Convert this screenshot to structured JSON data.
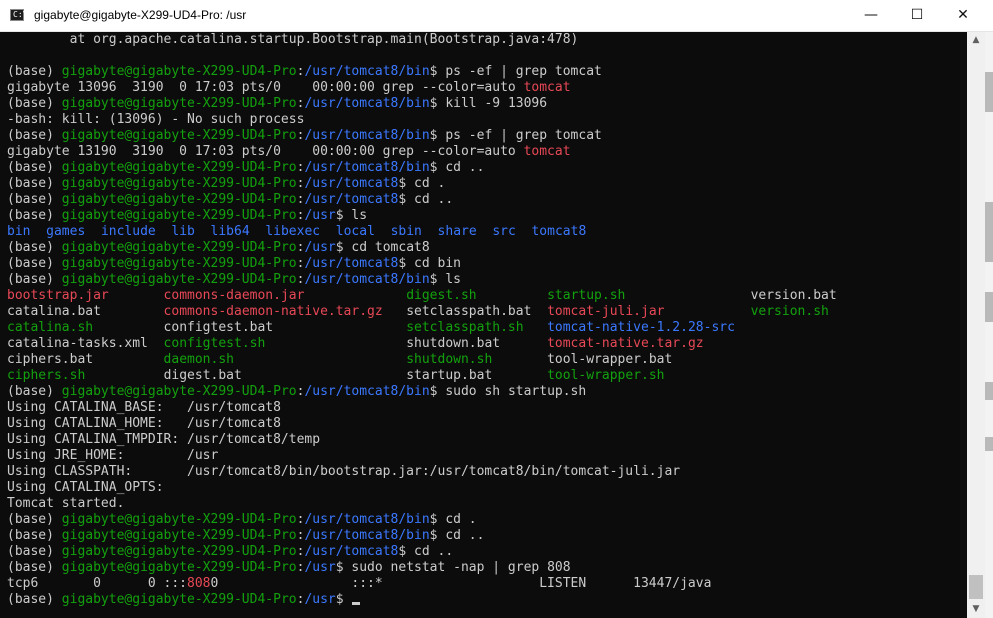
{
  "window": {
    "title": "gigabyte@gigabyte-X299-UD4-Pro: /usr",
    "icon": "terminal-icon",
    "icon_glyph": "C:\\",
    "minimize_glyph": "—",
    "maximize_glyph": "☐",
    "close_glyph": "✕"
  },
  "scrollbar": {
    "up_glyph": "▲",
    "down_glyph": "▼",
    "position": 0.97
  },
  "colors": {
    "background": "#0c0c0c",
    "text": "#cccccc",
    "prompt_user": "#13a10e",
    "prompt_path": "#3b78ff",
    "directory": "#3b78ff",
    "executable": "#13a10e",
    "archive": "#e74856",
    "match": "#e74856"
  },
  "terminal": {
    "lines": [
      [
        [
          "w",
          "        at org.apache.catalina.startup.Bootstrap.main(Bootstrap.java:478)"
        ]
      ],
      [
        [
          "w",
          ""
        ]
      ],
      [
        [
          "w",
          "(base) "
        ],
        [
          "g",
          "gigabyte@gigabyte-X299-UD4-Pro"
        ],
        [
          "w",
          ":"
        ],
        [
          "b",
          "/usr/tomcat8/bin"
        ],
        [
          "w",
          "$ ps -ef | grep tomcat"
        ]
      ],
      [
        [
          "w",
          "gigabyte 13096  3190  0 17:03 pts/0    00:00:00 grep --color=auto "
        ],
        [
          "r",
          "tomcat"
        ]
      ],
      [
        [
          "w",
          "(base) "
        ],
        [
          "g",
          "gigabyte@gigabyte-X299-UD4-Pro"
        ],
        [
          "w",
          ":"
        ],
        [
          "b",
          "/usr/tomcat8/bin"
        ],
        [
          "w",
          "$ kill -9 13096"
        ]
      ],
      [
        [
          "w",
          "-bash: kill: (13096) - No such process"
        ]
      ],
      [
        [
          "w",
          "(base) "
        ],
        [
          "g",
          "gigabyte@gigabyte-X299-UD4-Pro"
        ],
        [
          "w",
          ":"
        ],
        [
          "b",
          "/usr/tomcat8/bin"
        ],
        [
          "w",
          "$ ps -ef | grep tomcat"
        ]
      ],
      [
        [
          "w",
          "gigabyte 13190  3190  0 17:03 pts/0    00:00:00 grep --color=auto "
        ],
        [
          "r",
          "tomcat"
        ]
      ],
      [
        [
          "w",
          "(base) "
        ],
        [
          "g",
          "gigabyte@gigabyte-X299-UD4-Pro"
        ],
        [
          "w",
          ":"
        ],
        [
          "b",
          "/usr/tomcat8/bin"
        ],
        [
          "w",
          "$ cd .."
        ]
      ],
      [
        [
          "w",
          "(base) "
        ],
        [
          "g",
          "gigabyte@gigabyte-X299-UD4-Pro"
        ],
        [
          "w",
          ":"
        ],
        [
          "b",
          "/usr/tomcat8"
        ],
        [
          "w",
          "$ cd ."
        ]
      ],
      [
        [
          "w",
          "(base) "
        ],
        [
          "g",
          "gigabyte@gigabyte-X299-UD4-Pro"
        ],
        [
          "w",
          ":"
        ],
        [
          "b",
          "/usr/tomcat8"
        ],
        [
          "w",
          "$ cd .."
        ]
      ],
      [
        [
          "w",
          "(base) "
        ],
        [
          "g",
          "gigabyte@gigabyte-X299-UD4-Pro"
        ],
        [
          "w",
          ":"
        ],
        [
          "b",
          "/usr"
        ],
        [
          "w",
          "$ ls"
        ]
      ],
      [
        [
          "b",
          "bin"
        ],
        [
          "w",
          "  "
        ],
        [
          "b",
          "games"
        ],
        [
          "w",
          "  "
        ],
        [
          "b",
          "include"
        ],
        [
          "w",
          "  "
        ],
        [
          "b",
          "lib"
        ],
        [
          "w",
          "  "
        ],
        [
          "b",
          "lib64"
        ],
        [
          "w",
          "  "
        ],
        [
          "b",
          "libexec"
        ],
        [
          "w",
          "  "
        ],
        [
          "b",
          "local"
        ],
        [
          "w",
          "  "
        ],
        [
          "b",
          "sbin"
        ],
        [
          "w",
          "  "
        ],
        [
          "b",
          "share"
        ],
        [
          "w",
          "  "
        ],
        [
          "b",
          "src"
        ],
        [
          "w",
          "  "
        ],
        [
          "b",
          "tomcat8"
        ]
      ],
      [
        [
          "w",
          "(base) "
        ],
        [
          "g",
          "gigabyte@gigabyte-X299-UD4-Pro"
        ],
        [
          "w",
          ":"
        ],
        [
          "b",
          "/usr"
        ],
        [
          "w",
          "$ cd tomcat8"
        ]
      ],
      [
        [
          "w",
          "(base) "
        ],
        [
          "g",
          "gigabyte@gigabyte-X299-UD4-Pro"
        ],
        [
          "w",
          ":"
        ],
        [
          "b",
          "/usr/tomcat8"
        ],
        [
          "w",
          "$ cd bin"
        ]
      ],
      [
        [
          "w",
          "(base) "
        ],
        [
          "g",
          "gigabyte@gigabyte-X299-UD4-Pro"
        ],
        [
          "w",
          ":"
        ],
        [
          "b",
          "/usr/tomcat8/bin"
        ],
        [
          "w",
          "$ ls"
        ]
      ],
      [
        [
          "r",
          "bootstrap.jar"
        ],
        [
          "w",
          "       "
        ],
        [
          "r",
          "commons-daemon.jar"
        ],
        [
          "w",
          "             "
        ],
        [
          "g",
          "digest.sh"
        ],
        [
          "w",
          "         "
        ],
        [
          "g",
          "startup.sh"
        ],
        [
          "w",
          "                "
        ],
        [
          "w",
          "version.bat"
        ]
      ],
      [
        [
          "w",
          "catalina.bat"
        ],
        [
          "w",
          "        "
        ],
        [
          "r",
          "commons-daemon-native.tar.gz"
        ],
        [
          "w",
          "   "
        ],
        [
          "w",
          "setclasspath.bat"
        ],
        [
          "w",
          "  "
        ],
        [
          "r",
          "tomcat-juli.jar"
        ],
        [
          "w",
          "           "
        ],
        [
          "g",
          "version.sh"
        ]
      ],
      [
        [
          "g",
          "catalina.sh"
        ],
        [
          "w",
          "         "
        ],
        [
          "w",
          "configtest.bat"
        ],
        [
          "w",
          "                 "
        ],
        [
          "g",
          "setclasspath.sh"
        ],
        [
          "w",
          "   "
        ],
        [
          "b",
          "tomcat-native-1.2.28-src"
        ]
      ],
      [
        [
          "w",
          "catalina-tasks.xml"
        ],
        [
          "w",
          "  "
        ],
        [
          "g",
          "configtest.sh"
        ],
        [
          "w",
          "                  "
        ],
        [
          "w",
          "shutdown.bat"
        ],
        [
          "w",
          "      "
        ],
        [
          "r",
          "tomcat-native.tar.gz"
        ]
      ],
      [
        [
          "w",
          "ciphers.bat"
        ],
        [
          "w",
          "         "
        ],
        [
          "g",
          "daemon.sh"
        ],
        [
          "w",
          "                      "
        ],
        [
          "g",
          "shutdown.sh"
        ],
        [
          "w",
          "       "
        ],
        [
          "w",
          "tool-wrapper.bat"
        ]
      ],
      [
        [
          "g",
          "ciphers.sh"
        ],
        [
          "w",
          "          "
        ],
        [
          "w",
          "digest.bat"
        ],
        [
          "w",
          "                     "
        ],
        [
          "w",
          "startup.bat"
        ],
        [
          "w",
          "       "
        ],
        [
          "g",
          "tool-wrapper.sh"
        ]
      ],
      [
        [
          "w",
          "(base) "
        ],
        [
          "g",
          "gigabyte@gigabyte-X299-UD4-Pro"
        ],
        [
          "w",
          ":"
        ],
        [
          "b",
          "/usr/tomcat8/bin"
        ],
        [
          "w",
          "$ sudo sh startup.sh"
        ]
      ],
      [
        [
          "w",
          "Using CATALINA_BASE:   /usr/tomcat8"
        ]
      ],
      [
        [
          "w",
          "Using CATALINA_HOME:   /usr/tomcat8"
        ]
      ],
      [
        [
          "w",
          "Using CATALINA_TMPDIR: /usr/tomcat8/temp"
        ]
      ],
      [
        [
          "w",
          "Using JRE_HOME:        /usr"
        ]
      ],
      [
        [
          "w",
          "Using CLASSPATH:       /usr/tomcat8/bin/bootstrap.jar:/usr/tomcat8/bin/tomcat-juli.jar"
        ]
      ],
      [
        [
          "w",
          "Using CATALINA_OPTS:"
        ]
      ],
      [
        [
          "w",
          "Tomcat started."
        ]
      ],
      [
        [
          "w",
          "(base) "
        ],
        [
          "g",
          "gigabyte@gigabyte-X299-UD4-Pro"
        ],
        [
          "w",
          ":"
        ],
        [
          "b",
          "/usr/tomcat8/bin"
        ],
        [
          "w",
          "$ cd ."
        ]
      ],
      [
        [
          "w",
          "(base) "
        ],
        [
          "g",
          "gigabyte@gigabyte-X299-UD4-Pro"
        ],
        [
          "w",
          ":"
        ],
        [
          "b",
          "/usr/tomcat8/bin"
        ],
        [
          "w",
          "$ cd .."
        ]
      ],
      [
        [
          "w",
          "(base) "
        ],
        [
          "g",
          "gigabyte@gigabyte-X299-UD4-Pro"
        ],
        [
          "w",
          ":"
        ],
        [
          "b",
          "/usr/tomcat8"
        ],
        [
          "w",
          "$ cd .."
        ]
      ],
      [
        [
          "w",
          "(base) "
        ],
        [
          "g",
          "gigabyte@gigabyte-X299-UD4-Pro"
        ],
        [
          "w",
          ":"
        ],
        [
          "b",
          "/usr"
        ],
        [
          "w",
          "$ sudo netstat -nap | grep 808"
        ]
      ],
      [
        [
          "w",
          "tcp6       0      0 :::"
        ],
        [
          "r",
          "808"
        ],
        [
          "w",
          "0                 :::*                    LISTEN      13447/java"
        ]
      ],
      [
        [
          "w",
          "(base) "
        ],
        [
          "g",
          "gigabyte@gigabyte-X299-UD4-Pro"
        ],
        [
          "w",
          ":"
        ],
        [
          "b",
          "/usr"
        ],
        [
          "w",
          "$ "
        ]
      ]
    ]
  }
}
